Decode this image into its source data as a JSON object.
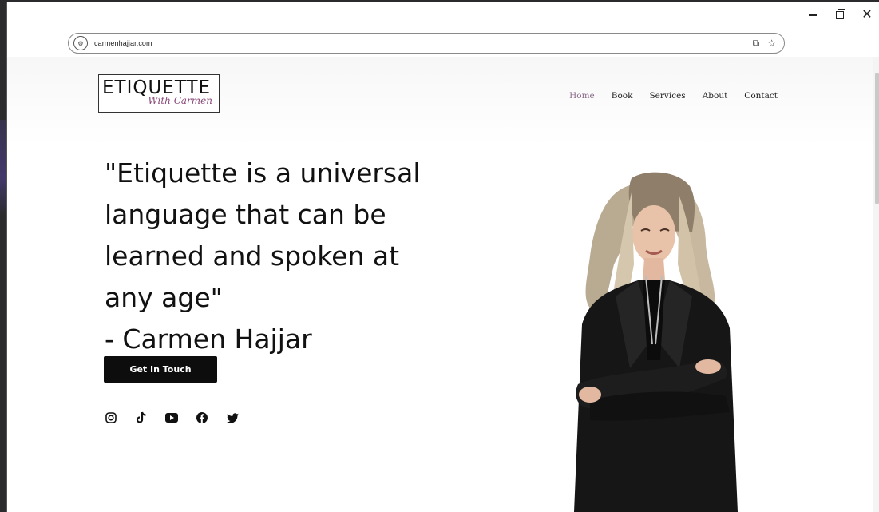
{
  "browser": {
    "url": "carmenhajjar.com",
    "window_controls": [
      "minimize",
      "restore",
      "close"
    ],
    "address_icons": [
      "install-app-icon",
      "bookmark-star-icon"
    ]
  },
  "site": {
    "logo": {
      "main": "ETIQUETTE",
      "sub": "With Carmen"
    },
    "nav": [
      {
        "label": "Home",
        "active": true
      },
      {
        "label": "Book",
        "active": false
      },
      {
        "label": "Services",
        "active": false
      },
      {
        "label": "About",
        "active": false
      },
      {
        "label": "Contact",
        "active": false
      }
    ],
    "quote_lines": [
      "\"Etiquette is a universal",
      "language that can be",
      "learned and spoken at",
      "any age\"",
      "- Carmen Hajjar"
    ],
    "cta_label": "Get In Touch",
    "socials": [
      "instagram-icon",
      "tiktok-icon",
      "youtube-icon",
      "facebook-icon",
      "twitter-icon"
    ]
  },
  "colors": {
    "accent_nav": "#8c6a8a",
    "button_bg": "#0d0d0d",
    "logo_sub": "#8a4a7a"
  }
}
